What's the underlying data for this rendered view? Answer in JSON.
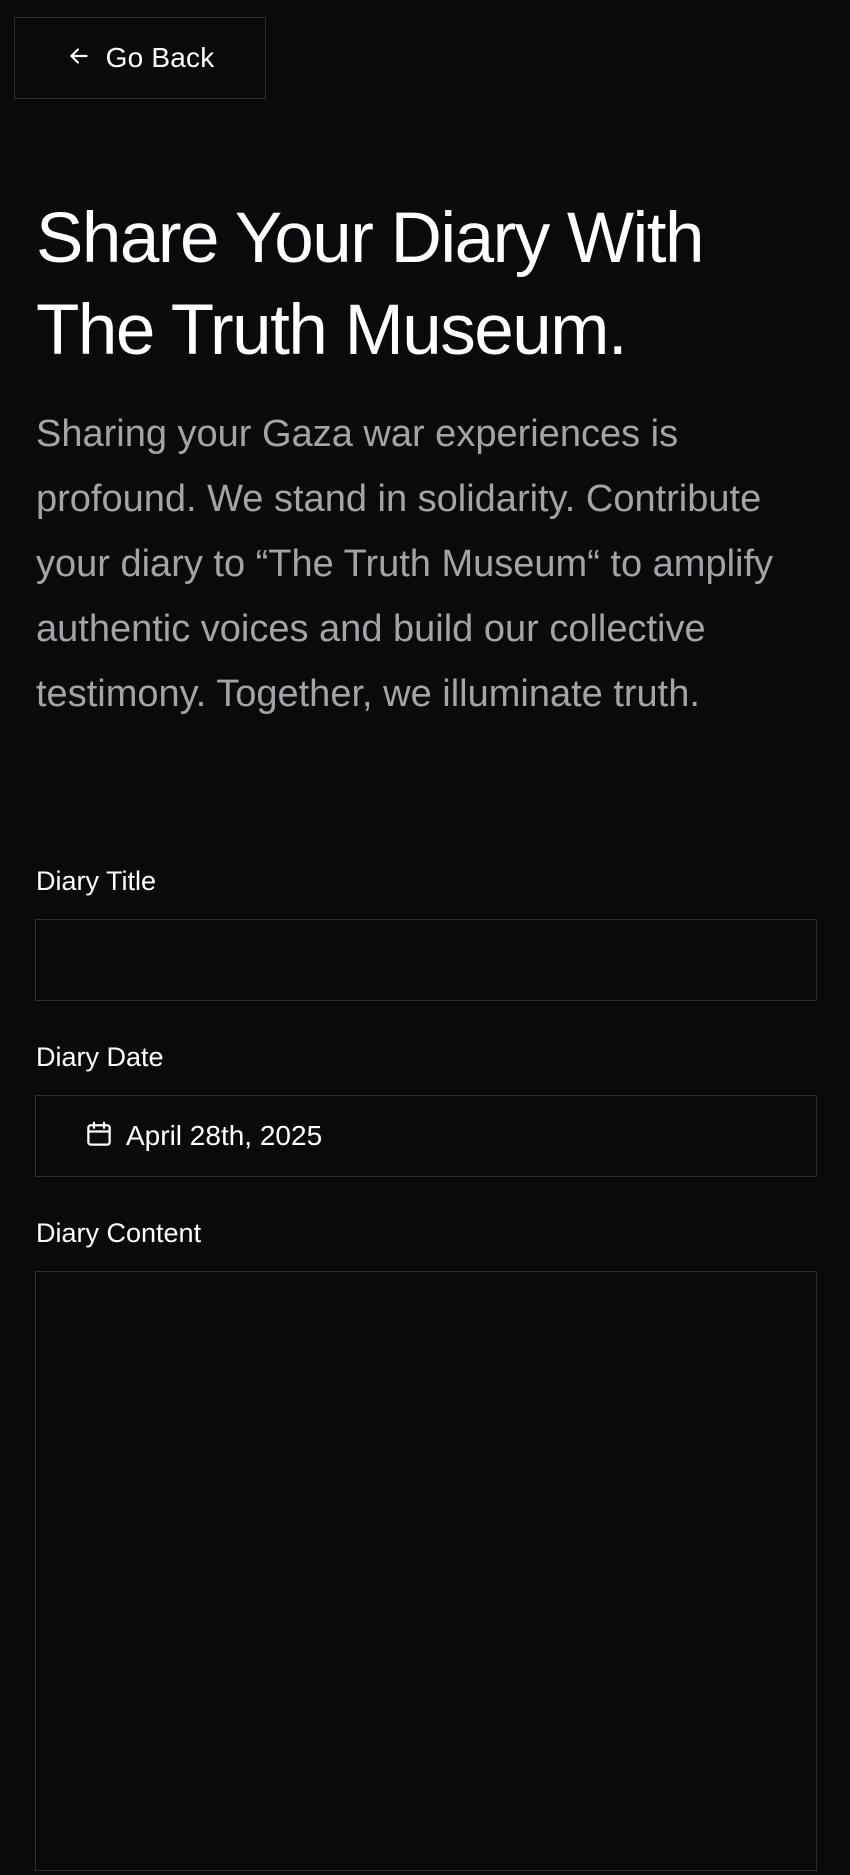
{
  "navigation": {
    "back_label": "Go Back"
  },
  "page": {
    "title": "Share Your Diary With The Truth Museum.",
    "intro": "Sharing your Gaza war experiences is profound. We stand in solidarity. Contribute your diary to “The Truth Museum“ to amplify authentic voices and build our collective testimony. Together, we illuminate truth."
  },
  "form": {
    "title_label": "Diary Title",
    "title_value": "",
    "date_label": "Diary Date",
    "date_value": "April 28th, 2025",
    "content_label": "Diary Content",
    "content_value": ""
  },
  "icons": {
    "back": "arrow-left-icon",
    "date": "calendar-icon"
  },
  "colors": {
    "background": "#0a0a0c",
    "border": "#2e2e32",
    "text": "#ffffff",
    "muted_text": "#a3a3a8"
  }
}
